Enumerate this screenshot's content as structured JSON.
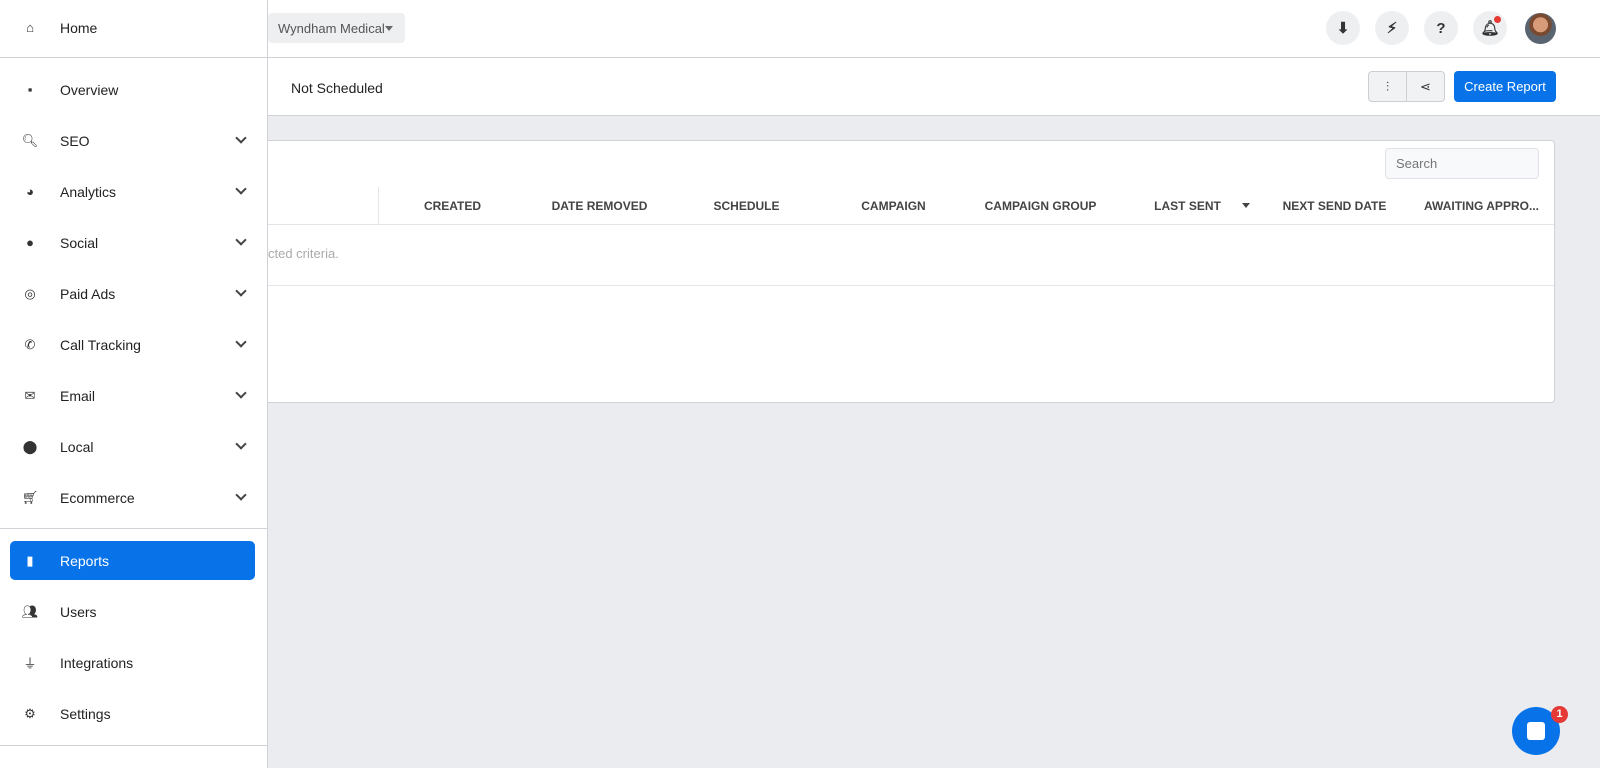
{
  "header": {
    "client_selector": "Wyndham Medical",
    "icons": [
      "folder-download-icon",
      "bolt-icon",
      "help-icon",
      "bell-icon"
    ],
    "notification_dot_color": "#e53935"
  },
  "toolbar": {
    "title": "Not Scheduled",
    "create_label": "Create Report",
    "accent": "#0873e8"
  },
  "table": {
    "search_placeholder": "Search",
    "columns": [
      "CREATED",
      "DATE REMOVED",
      "SCHEDULE",
      "CAMPAIGN",
      "CAMPAIGN GROUP",
      "LAST SENT",
      "NEXT SEND DATE",
      "AWAITING APPRO..."
    ],
    "sorted_column": "LAST SENT",
    "empty_text": "cted criteria."
  },
  "sidebar": {
    "home": "Home",
    "items": [
      {
        "label": "Overview",
        "icon": "grid-icon",
        "glyph": "▪",
        "chev": false
      },
      {
        "label": "SEO",
        "icon": "search-icon",
        "glyph": "🔍︎",
        "chev": true
      },
      {
        "label": "Analytics",
        "icon": "pie-chart-icon",
        "glyph": "◕",
        "chev": true
      },
      {
        "label": "Social",
        "icon": "comment-icon",
        "glyph": "●",
        "chev": true
      },
      {
        "label": "Paid Ads",
        "icon": "target-icon",
        "glyph": "◎",
        "chev": true
      },
      {
        "label": "Call Tracking",
        "icon": "phone-icon",
        "glyph": "✆",
        "chev": true
      },
      {
        "label": "Email",
        "icon": "envelope-icon",
        "glyph": "✉",
        "chev": true
      },
      {
        "label": "Local",
        "icon": "map-pin-icon",
        "glyph": "⬤",
        "chev": true
      },
      {
        "label": "Ecommerce",
        "icon": "cart-icon",
        "glyph": "🛒︎",
        "chev": true
      }
    ],
    "bottom": [
      {
        "label": "Reports",
        "icon": "report-file-icon",
        "glyph": "▮",
        "active": true
      },
      {
        "label": "Users",
        "icon": "users-icon",
        "glyph": "👥︎",
        "active": false
      },
      {
        "label": "Integrations",
        "icon": "plug-icon",
        "glyph": "⏚",
        "active": false
      },
      {
        "label": "Settings",
        "icon": "gear-icon",
        "glyph": "⚙",
        "active": false
      }
    ]
  },
  "chat": {
    "badge": "1"
  }
}
